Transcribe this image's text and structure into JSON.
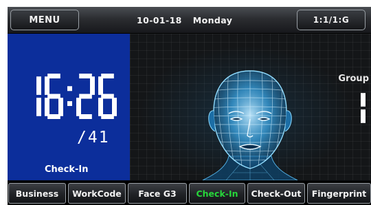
{
  "header": {
    "menu_label": "MENU",
    "date": "10-01-18",
    "weekday": "Monday",
    "status_label": "1:1/1:G"
  },
  "clock": {
    "time": "16:26",
    "seconds": "/41",
    "state_label": "Check-In"
  },
  "verify": {
    "group_label": "Group",
    "group_value": "1"
  },
  "tabs": [
    {
      "label": "Business"
    },
    {
      "label": "WorkCode"
    },
    {
      "label": "Face G3"
    },
    {
      "label": "Check-In",
      "active": true
    },
    {
      "label": "Check-Out"
    },
    {
      "label": "Fingerprint"
    }
  ],
  "colors": {
    "clock_panel": "#0c2e9b",
    "active_tab_text": "#27d63a",
    "face_wire": "#3fb0ff"
  }
}
